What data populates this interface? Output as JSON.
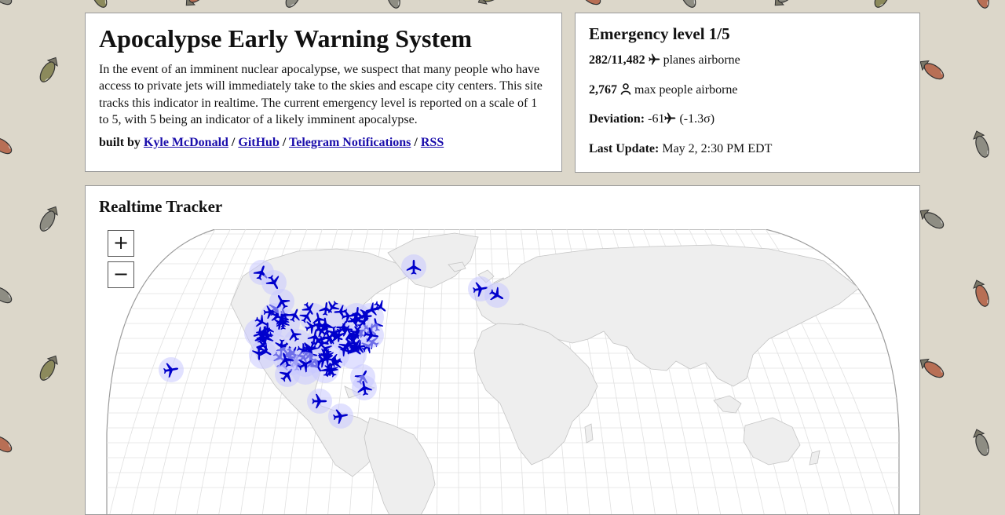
{
  "header": {
    "title": "Apocalypse Early Warning System",
    "description": "In the event of an imminent nuclear apocalypse, we suspect that many people who have access to private jets will immediately take to the skies and escape city centers. This site tracks this indicator in realtime. The current emergency level is reported on a scale of 1 to 5, with 5 being an indicator of a likely imminent apocalypse.",
    "built_by": "built by",
    "sep": "/",
    "links": [
      "Kyle McDonald",
      "GitHub",
      "Telegram Notifications",
      "RSS"
    ]
  },
  "status": {
    "emergency_level": "Emergency level 1/5",
    "planes": "282/11,482",
    "planes_label": "planes airborne",
    "people": "2,767",
    "people_label": "max people airborne",
    "deviation_label": "Deviation:",
    "deviation_value": "-61",
    "deviation_sigma": "(-1.3σ)",
    "last_update_label": "Last Update:",
    "last_update_value": "May 2, 2:30 PM EDT"
  },
  "tracker": {
    "title": "Realtime Tracker",
    "zoom_in": "+",
    "zoom_out": "−"
  },
  "colors": {
    "background": "#dcd7ca",
    "plane": "#0000cc",
    "halo": "#c8c8ff",
    "land": "#eeeeee",
    "link": "#1a0dab"
  },
  "icons": [
    "airplane-icon",
    "person-icon",
    "bomb-icon"
  ]
}
